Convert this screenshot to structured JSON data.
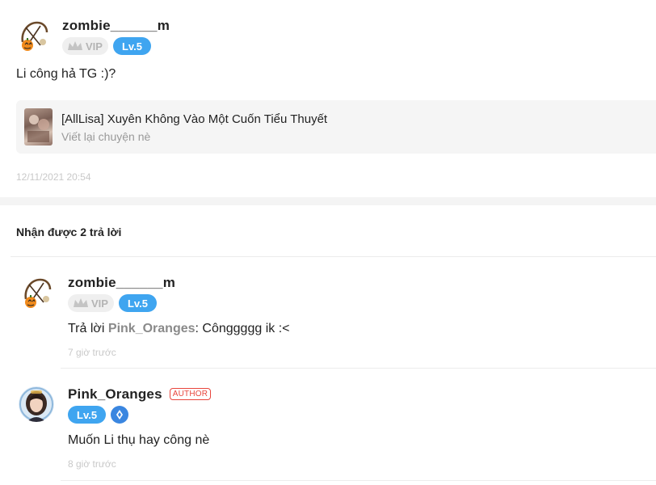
{
  "post": {
    "username": "zombie______m",
    "vip_label": "VIP",
    "level": "Lv.5",
    "text": "Li công hả TG :)?",
    "book": {
      "title": "[AllLisa] Xuyên Không Vào Một Cuốn Tiểu Thuyết",
      "subtitle": "Viết lại chuyện nè"
    },
    "timestamp": "12/11/2021 20:54"
  },
  "replies_header": "Nhận được 2 trả lời",
  "replies": [
    {
      "username": "zombie______m",
      "vip_label": "VIP",
      "level": "Lv.5",
      "reply_prefix": "Trả lời ",
      "mention": "Pink_Oranges",
      "text": ": Cônggggg ik :<",
      "time": "7 giờ trước"
    },
    {
      "username": "Pink_Oranges",
      "author_badge": "AUTHOR",
      "level": "Lv.5",
      "text": "Muốn Li thụ hay công nè",
      "time": "8 giờ trước"
    }
  ],
  "colors": {
    "level_badge": "#3fa5f0",
    "author_badge": "#e8453c",
    "medal": "#3a86e0"
  }
}
